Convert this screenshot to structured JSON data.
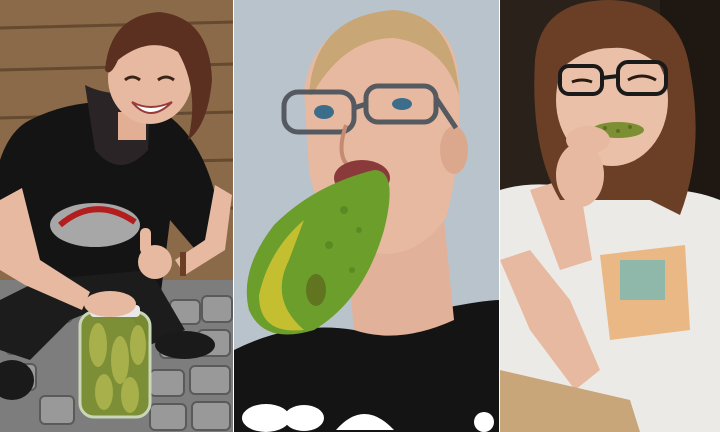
{
  "collage": {
    "panels": [
      {
        "id": "left",
        "scene": "woman-with-pickle-jar"
      },
      {
        "id": "center",
        "scene": "man-with-giant-cucumber"
      },
      {
        "id": "right",
        "scene": "girl-with-small-pickle"
      }
    ]
  },
  "colors": {
    "wood": "#8a6a48",
    "cobblestone": "#7d7d7d",
    "shirt_black": "#141414",
    "wall_grey": "#b9c3cb",
    "cucumber_green": "#6c9e2c",
    "cucumber_yellow": "#d3c431",
    "room_dark": "#2a211a",
    "skin": "#e7b9a0",
    "hair_brown": "#6b3f26"
  }
}
